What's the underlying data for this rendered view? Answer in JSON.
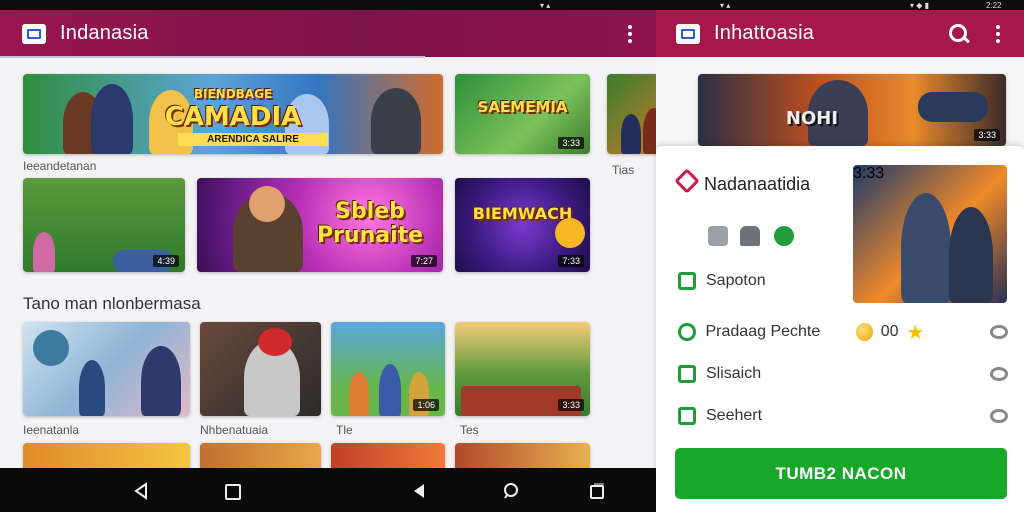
{
  "status": {
    "left_icons": "▾ ▴",
    "right_icons": "▾ ◆ ▮",
    "right_time": "2:22"
  },
  "left_app": {
    "title": "Indanasia"
  },
  "right_app": {
    "title": "Inhattoasia"
  },
  "tiles": {
    "hero": {
      "title": "CAMADIA",
      "kicker": "BIENDBAGE",
      "sub": "ARENDICA SALIRE"
    },
    "t2": {
      "title": "SAEMEMIA",
      "badge": "3:33"
    },
    "t4": {
      "badge": "4:39"
    },
    "t5": {
      "title": "Sbleb Prunaite",
      "badge": "7:27"
    },
    "t6": {
      "title": "BIEMWACH",
      "badge": "7:33"
    },
    "t9": {
      "badge": "1:06"
    },
    "t10": {
      "badge": "3:33"
    },
    "r1": {
      "title": "NOHI",
      "badge": "3:33"
    }
  },
  "captions": {
    "row1": "Ieeandetanan",
    "row1_right": "Tias",
    "section": "Tano man nlonbermasa",
    "row3_a": "Ieenatanla",
    "row3_b": "Nhbenatuaia",
    "row3_c": "Tle",
    "row3_d": "Tes"
  },
  "sheet": {
    "title": "Nadanaatidia",
    "image_badge": "3:33",
    "rows": [
      {
        "label": "Sapoton"
      },
      {
        "label": "Pradaag Pechte",
        "score": "00"
      },
      {
        "label": "Slisaich"
      },
      {
        "label": "Seehert"
      }
    ],
    "cta": "TUMB2 NACON"
  },
  "colors": {
    "accent": "#a6174a",
    "cta": "#17a829",
    "icon_green": "#1f9d3a"
  }
}
